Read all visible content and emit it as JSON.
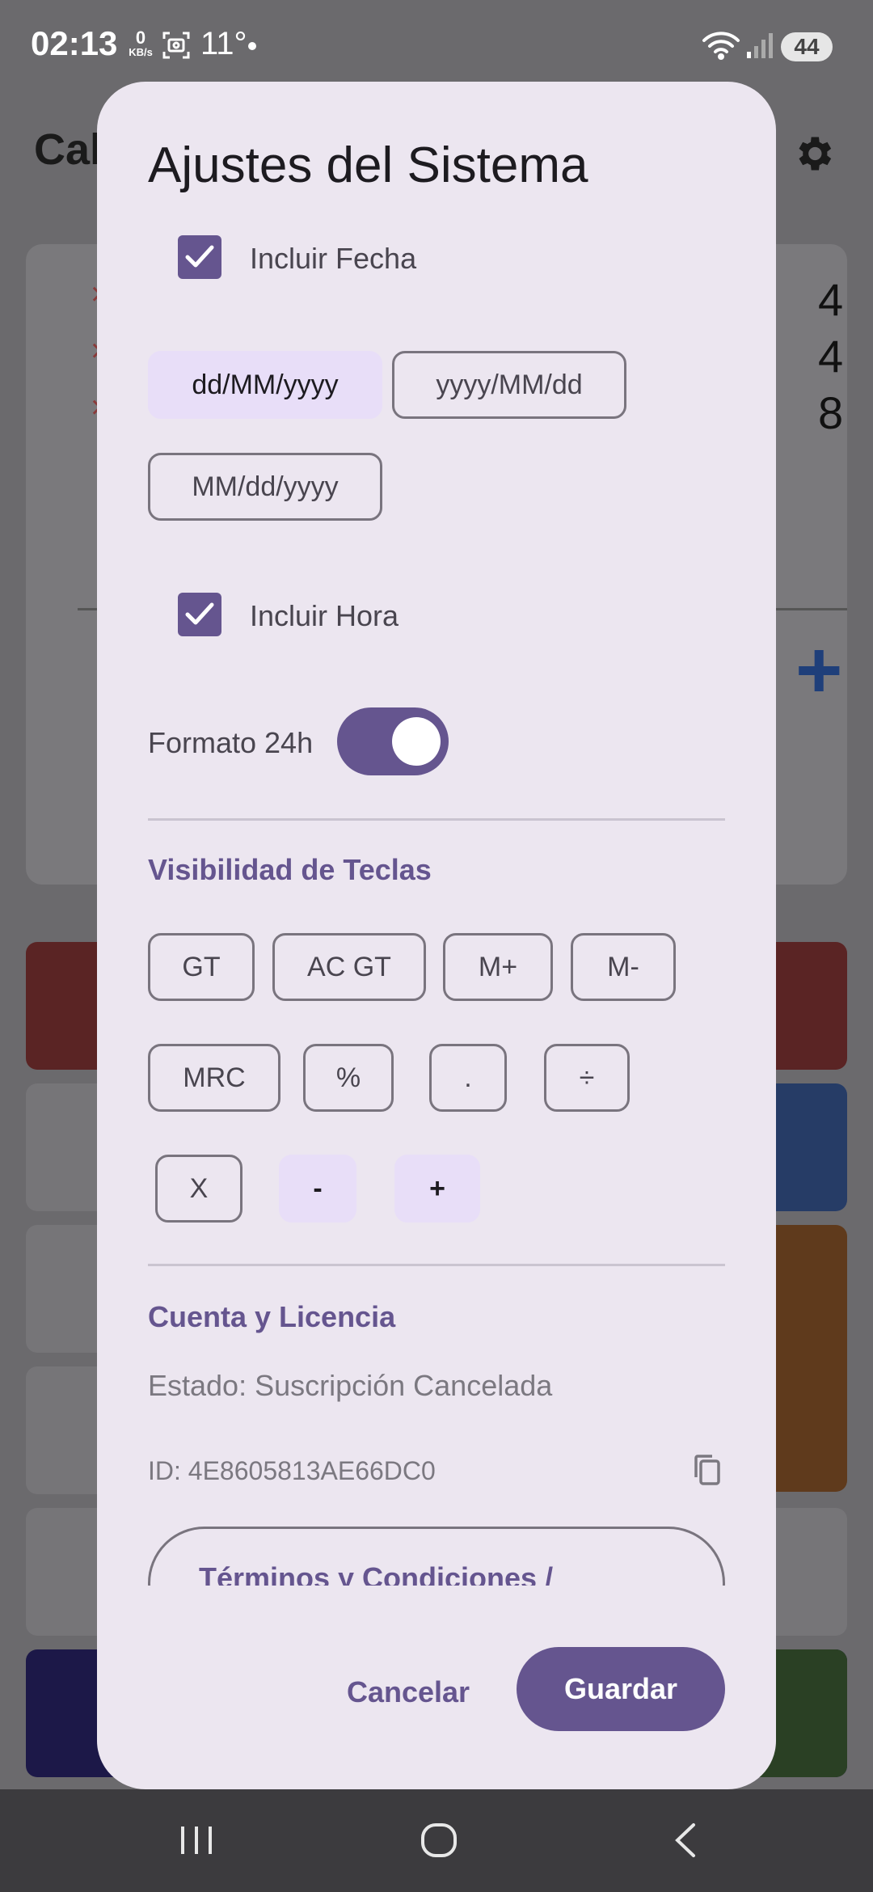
{
  "status_bar": {
    "time": "02:13",
    "net_speed": "0",
    "net_unit": "KB/s",
    "temperature": "11°",
    "battery": "44"
  },
  "background": {
    "title": "Cal",
    "rows": [
      {
        "mark": "×",
        "value": "4"
      },
      {
        "mark": "×",
        "value": "4"
      },
      {
        "mark": "×",
        "value": "8"
      }
    ],
    "add_symbol": "+"
  },
  "dialog": {
    "title": "Ajustes del Sistema",
    "include_date": {
      "label": "Incluir Fecha",
      "checked": true
    },
    "date_formats": [
      {
        "label": "dd/MM/yyyy",
        "selected": true
      },
      {
        "label": "yyyy/MM/dd",
        "selected": false
      },
      {
        "label": "MM/dd/yyyy",
        "selected": false
      }
    ],
    "include_time": {
      "label": "Incluir Hora",
      "checked": true
    },
    "format_24h": {
      "label": "Formato 24h",
      "on": true
    },
    "keys_section": {
      "title": "Visibilidad de Teclas",
      "keys": [
        {
          "label": "GT",
          "visible": true
        },
        {
          "label": "AC GT",
          "visible": true
        },
        {
          "label": "M+",
          "visible": true
        },
        {
          "label": "M-",
          "visible": true
        },
        {
          "label": "MRC",
          "visible": true
        },
        {
          "label": "%",
          "visible": true
        },
        {
          "label": ".",
          "visible": true
        },
        {
          "label": "÷",
          "visible": true
        },
        {
          "label": "X",
          "visible": true
        },
        {
          "label": "-",
          "visible": false
        },
        {
          "label": "+",
          "visible": false
        }
      ]
    },
    "account_section": {
      "title": "Cuenta y Licencia",
      "status": "Estado: Suscripción Cancelada",
      "id": "ID: 4E8605813AE66DC0",
      "terms_label": "Términos y Condiciones /"
    },
    "cancel_label": "Cancelar",
    "save_label": "Guardar"
  },
  "colors": {
    "accent": "#65558f",
    "dialog_bg": "#ece6f0",
    "chip_selected": "#e8def8",
    "scrim": "#6b6a6d"
  }
}
